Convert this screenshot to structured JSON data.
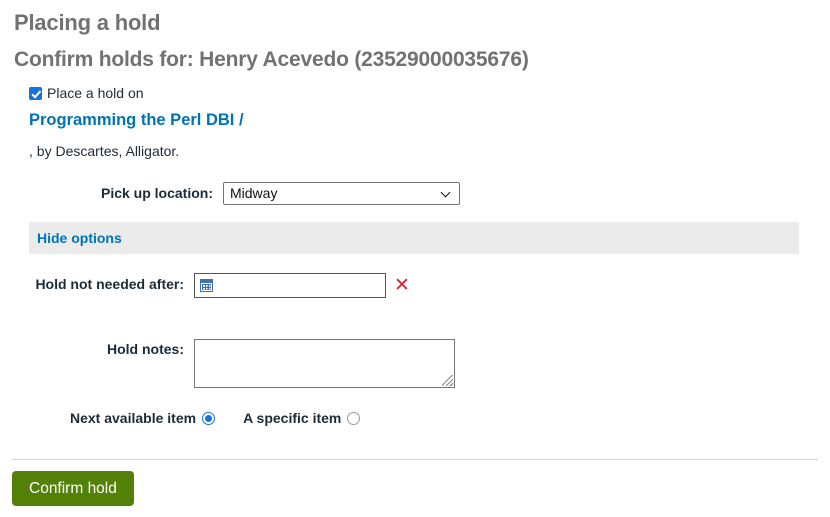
{
  "page": {
    "heading": "Placing a hold",
    "subheading": "Confirm holds for: Henry Acevedo (23529000035676)"
  },
  "hold": {
    "checkbox_label": "Place a hold on",
    "checkbox_checked": true,
    "record_title": "Programming the Perl DBI /",
    "record_author": ", by Descartes, Alligator."
  },
  "pickup": {
    "label": "Pick up location:",
    "selected": "Midway",
    "options": [
      "Midway"
    ],
    "chevron_icon": "chevron-down-icon"
  },
  "options_bar": {
    "toggle_label": "Hide options"
  },
  "not_needed_after": {
    "label": "Hold not needed after:",
    "value": "",
    "placeholder": "",
    "calendar_icon": "calendar-icon",
    "clear_icon": "close-x-icon",
    "clear_glyph": "✕"
  },
  "hold_notes": {
    "label": "Hold notes:",
    "value": "",
    "placeholder": ""
  },
  "item_type": {
    "next_available_label": "Next available item",
    "next_available_selected": true,
    "specific_label": "A specific item",
    "specific_selected": false
  },
  "footer": {
    "confirm_label": "Confirm hold"
  },
  "colors": {
    "heading_gray": "#727272",
    "link_blue": "#0073b5",
    "accent_blue": "#1a73d6",
    "confirm_green": "#538006",
    "clear_red": "#d9232d",
    "bar_gray": "#ebebeb"
  }
}
